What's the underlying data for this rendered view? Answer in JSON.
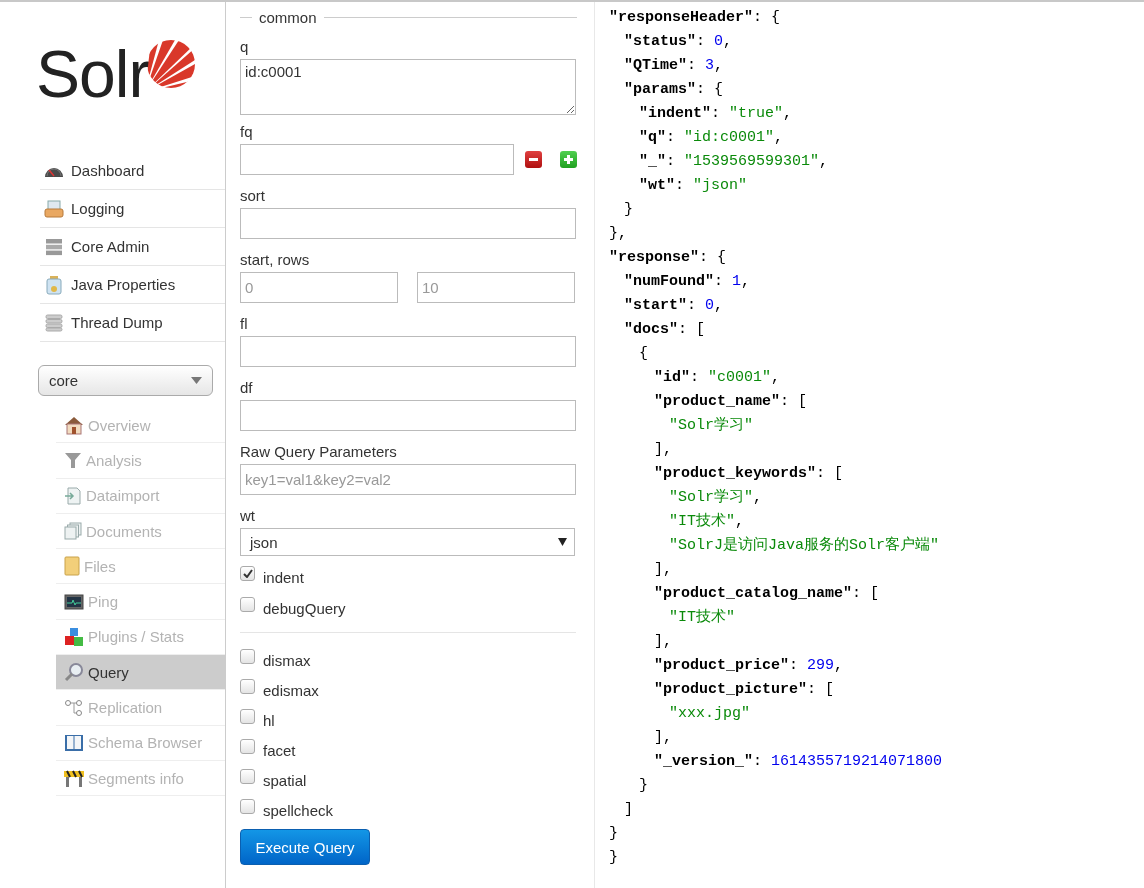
{
  "logo": {
    "text": "Solr"
  },
  "main_menu": [
    {
      "label": "Dashboard"
    },
    {
      "label": "Logging"
    },
    {
      "label": "Core Admin"
    },
    {
      "label": "Java Properties"
    },
    {
      "label": "Thread Dump"
    }
  ],
  "core_selector": {
    "value": "core"
  },
  "core_menu": [
    {
      "label": "Overview",
      "selected": false
    },
    {
      "label": "Analysis",
      "selected": false
    },
    {
      "label": "Dataimport",
      "selected": false
    },
    {
      "label": "Documents",
      "selected": false
    },
    {
      "label": "Files",
      "selected": false
    },
    {
      "label": "Ping",
      "selected": false
    },
    {
      "label": "Plugins / Stats",
      "selected": false
    },
    {
      "label": "Query",
      "selected": true
    },
    {
      "label": "Replication",
      "selected": false
    },
    {
      "label": "Schema Browser",
      "selected": false
    },
    {
      "label": "Segments info",
      "selected": false
    }
  ],
  "form": {
    "legend": "common",
    "fields": [
      {
        "kind": "textarea",
        "label": "q",
        "value": "id:c0001"
      },
      {
        "kind": "input_with_buttons",
        "label": "fq"
      },
      {
        "kind": "input",
        "label": "sort"
      },
      {
        "kind": "pair",
        "label": "start, rows",
        "inputs": [
          {
            "placeholder": "0"
          },
          {
            "placeholder": "10"
          }
        ]
      },
      {
        "kind": "input",
        "label": "fl"
      },
      {
        "kind": "input",
        "label": "df"
      },
      {
        "kind": "input",
        "label": "Raw Query Parameters",
        "placeholder": "key1=val1&key2=val2"
      },
      {
        "kind": "select",
        "label": "wt",
        "value": "json"
      }
    ],
    "options": [
      {
        "label": "indent",
        "checked": true
      },
      {
        "label": "debugQuery",
        "checked": false
      }
    ],
    "parsers": [
      {
        "label": "dismax",
        "checked": false
      },
      {
        "label": "edismax",
        "checked": false
      },
      {
        "label": "hl",
        "checked": false
      },
      {
        "label": "facet",
        "checked": false
      },
      {
        "label": "spatial",
        "checked": false
      },
      {
        "label": "spellcheck",
        "checked": false
      }
    ],
    "submit": "Execute Query"
  },
  "result": {
    "lines": [
      {
        "children": [
          {
            "tokens": [
              {
                "kind": "key",
                "text": "\"responseHeader\""
              },
              {
                "kind": "punct",
                "text": ": {"
              }
            ],
            "children": [
              {
                "tokens": [
                  {
                    "kind": "key",
                    "text": "\"status\""
                  },
                  {
                    "kind": "punct",
                    "text": ": "
                  },
                  {
                    "kind": "number",
                    "text": "0"
                  },
                  {
                    "kind": "punct",
                    "text": ","
                  }
                ]
              },
              {
                "tokens": [
                  {
                    "kind": "key",
                    "text": "\"QTime\""
                  },
                  {
                    "kind": "punct",
                    "text": ": "
                  },
                  {
                    "kind": "number",
                    "text": "3"
                  },
                  {
                    "kind": "punct",
                    "text": ","
                  }
                ]
              },
              {
                "tokens": [
                  {
                    "kind": "key",
                    "text": "\"params\""
                  },
                  {
                    "kind": "punct",
                    "text": ": {"
                  }
                ],
                "children": [
                  {
                    "tokens": [
                      {
                        "kind": "key",
                        "text": "\"indent\""
                      },
                      {
                        "kind": "punct",
                        "text": ": "
                      },
                      {
                        "kind": "string",
                        "text": "\"true\""
                      },
                      {
                        "kind": "punct",
                        "text": ","
                      }
                    ]
                  },
                  {
                    "tokens": [
                      {
                        "kind": "key",
                        "text": "\"q\""
                      },
                      {
                        "kind": "punct",
                        "text": ": "
                      },
                      {
                        "kind": "string",
                        "text": "\"id:c0001\""
                      },
                      {
                        "kind": "punct",
                        "text": ","
                      }
                    ]
                  },
                  {
                    "tokens": [
                      {
                        "kind": "key",
                        "text": "\"_\""
                      },
                      {
                        "kind": "punct",
                        "text": ": "
                      },
                      {
                        "kind": "string",
                        "text": "\"1539569599301\""
                      },
                      {
                        "kind": "punct",
                        "text": ","
                      }
                    ]
                  },
                  {
                    "tokens": [
                      {
                        "kind": "key",
                        "text": "\"wt\""
                      },
                      {
                        "kind": "punct",
                        "text": ": "
                      },
                      {
                        "kind": "string",
                        "text": "\"json\""
                      }
                    ]
                  }
                ]
              },
              {
                "tokens": [
                  {
                    "kind": "punct",
                    "text": "}"
                  }
                ]
              }
            ]
          },
          {
            "tokens": [
              {
                "kind": "punct",
                "text": "},"
              }
            ]
          },
          {
            "tokens": [
              {
                "kind": "key",
                "text": "\"response\""
              },
              {
                "kind": "punct",
                "text": ": {"
              }
            ],
            "children": [
              {
                "tokens": [
                  {
                    "kind": "key",
                    "text": "\"numFound\""
                  },
                  {
                    "kind": "punct",
                    "text": ": "
                  },
                  {
                    "kind": "number",
                    "text": "1"
                  },
                  {
                    "kind": "punct",
                    "text": ","
                  }
                ]
              },
              {
                "tokens": [
                  {
                    "kind": "key",
                    "text": "\"start\""
                  },
                  {
                    "kind": "punct",
                    "text": ": "
                  },
                  {
                    "kind": "number",
                    "text": "0"
                  },
                  {
                    "kind": "punct",
                    "text": ","
                  }
                ]
              },
              {
                "tokens": [
                  {
                    "kind": "key",
                    "text": "\"docs\""
                  },
                  {
                    "kind": "punct",
                    "text": ": ["
                  }
                ],
                "children": [
                  {
                    "tokens": [
                      {
                        "kind": "punct",
                        "text": "{"
                      }
                    ],
                    "children": [
                      {
                        "tokens": [
                          {
                            "kind": "key",
                            "text": "\"id\""
                          },
                          {
                            "kind": "punct",
                            "text": ": "
                          },
                          {
                            "kind": "string",
                            "text": "\"c0001\""
                          },
                          {
                            "kind": "punct",
                            "text": ","
                          }
                        ]
                      },
                      {
                        "tokens": [
                          {
                            "kind": "key",
                            "text": "\"product_name\""
                          },
                          {
                            "kind": "punct",
                            "text": ": ["
                          }
                        ],
                        "children": [
                          {
                            "tokens": [
                              {
                                "kind": "string",
                                "text": "\"Solr学习\""
                              }
                            ]
                          }
                        ]
                      },
                      {
                        "tokens": [
                          {
                            "kind": "punct",
                            "text": "],"
                          }
                        ]
                      },
                      {
                        "tokens": [
                          {
                            "kind": "key",
                            "text": "\"product_keywords\""
                          },
                          {
                            "kind": "punct",
                            "text": ": ["
                          }
                        ],
                        "children": [
                          {
                            "tokens": [
                              {
                                "kind": "string",
                                "text": "\"Solr学习\""
                              },
                              {
                                "kind": "punct",
                                "text": ","
                              }
                            ]
                          },
                          {
                            "tokens": [
                              {
                                "kind": "string",
                                "text": "\"IT技术\""
                              },
                              {
                                "kind": "punct",
                                "text": ","
                              }
                            ]
                          },
                          {
                            "tokens": [
                              {
                                "kind": "string",
                                "text": "\"SolrJ是访问Java服务的Solr客户端\""
                              }
                            ]
                          }
                        ]
                      },
                      {
                        "tokens": [
                          {
                            "kind": "punct",
                            "text": "],"
                          }
                        ]
                      },
                      {
                        "tokens": [
                          {
                            "kind": "key",
                            "text": "\"product_catalog_name\""
                          },
                          {
                            "kind": "punct",
                            "text": ": ["
                          }
                        ],
                        "children": [
                          {
                            "tokens": [
                              {
                                "kind": "string",
                                "text": "\"IT技术\""
                              }
                            ]
                          }
                        ]
                      },
                      {
                        "tokens": [
                          {
                            "kind": "punct",
                            "text": "],"
                          }
                        ]
                      },
                      {
                        "tokens": [
                          {
                            "kind": "key",
                            "text": "\"product_price\""
                          },
                          {
                            "kind": "punct",
                            "text": ": "
                          },
                          {
                            "kind": "number",
                            "text": "299"
                          },
                          {
                            "kind": "punct",
                            "text": ","
                          }
                        ]
                      },
                      {
                        "tokens": [
                          {
                            "kind": "key",
                            "text": "\"product_picture\""
                          },
                          {
                            "kind": "punct",
                            "text": ": ["
                          }
                        ],
                        "children": [
                          {
                            "tokens": [
                              {
                                "kind": "string",
                                "text": "\"xxx.jpg\""
                              }
                            ]
                          }
                        ]
                      },
                      {
                        "tokens": [
                          {
                            "kind": "punct",
                            "text": "],"
                          }
                        ]
                      },
                      {
                        "tokens": [
                          {
                            "kind": "key",
                            "text": "\"_version_\""
                          },
                          {
                            "kind": "punct",
                            "text": ": "
                          },
                          {
                            "kind": "number",
                            "text": "1614355719214071800"
                          }
                        ]
                      }
                    ]
                  },
                  {
                    "tokens": [
                      {
                        "kind": "punct",
                        "text": "}"
                      }
                    ]
                  }
                ]
              },
              {
                "tokens": [
                  {
                    "kind": "punct",
                    "text": "]"
                  }
                ]
              }
            ]
          },
          {
            "tokens": [
              {
                "kind": "punct",
                "text": "}"
              }
            ]
          }
        ]
      },
      {
        "tokens": [
          {
            "kind": "punct",
            "text": "}"
          }
        ]
      }
    ]
  }
}
